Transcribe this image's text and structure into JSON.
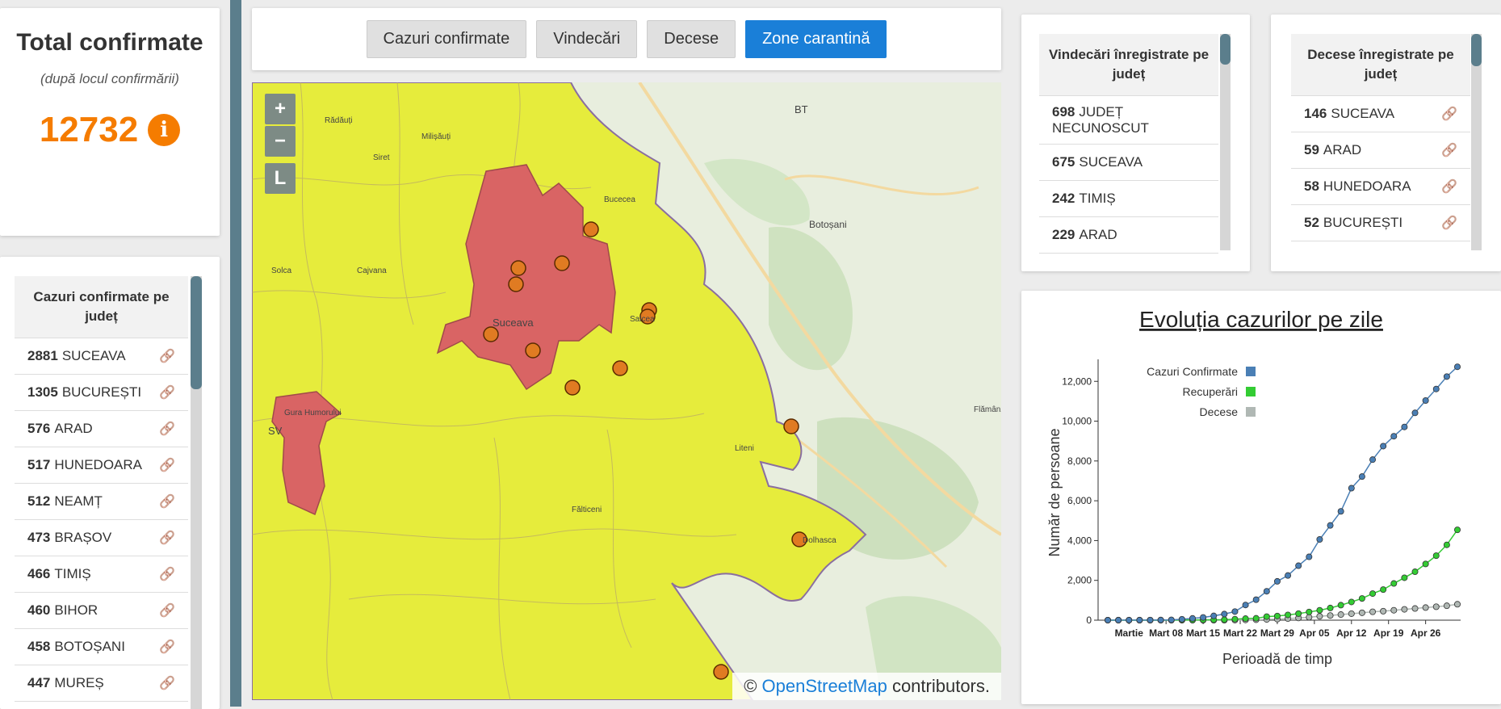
{
  "total": {
    "title": "Total confirmate",
    "subtitle": "(după locul confirmării)",
    "value": "12732",
    "info_icon": "i"
  },
  "tabs": [
    {
      "label": "Cazuri confirmate",
      "active": false
    },
    {
      "label": "Vindecări",
      "active": false
    },
    {
      "label": "Decese",
      "active": false
    },
    {
      "label": "Zone carantină",
      "active": true
    }
  ],
  "county_list": {
    "title": "Cazuri confirmate pe județ",
    "rows": [
      {
        "count": "2881",
        "name": "SUCEAVA"
      },
      {
        "count": "1305",
        "name": "BUCUREȘTI"
      },
      {
        "count": "576",
        "name": "ARAD"
      },
      {
        "count": "517",
        "name": "HUNEDOARA"
      },
      {
        "count": "512",
        "name": "NEAMȚ"
      },
      {
        "count": "473",
        "name": "BRAȘOV"
      },
      {
        "count": "466",
        "name": "TIMIȘ"
      },
      {
        "count": "460",
        "name": "BIHOR"
      },
      {
        "count": "458",
        "name": "BOTOȘANI"
      },
      {
        "count": "447",
        "name": "MUREȘ"
      }
    ]
  },
  "recoveries_list": {
    "title": "Vindecări înregistrate pe județ",
    "rows": [
      {
        "count": "698",
        "name": "JUDEȚ NECUNOSCUT"
      },
      {
        "count": "675",
        "name": "SUCEAVA"
      },
      {
        "count": "242",
        "name": "TIMIȘ"
      },
      {
        "count": "229",
        "name": "ARAD"
      }
    ]
  },
  "deaths_list": {
    "title": "Decese înregistrate pe județ",
    "rows": [
      {
        "count": "146",
        "name": "SUCEAVA"
      },
      {
        "count": "59",
        "name": "ARAD"
      },
      {
        "count": "58",
        "name": "HUNEDOARA"
      },
      {
        "count": "52",
        "name": "BUCUREȘTI"
      }
    ]
  },
  "map": {
    "zoom_in": "+",
    "zoom_out": "−",
    "layers": "L",
    "labels": {
      "suceava": "Suceava",
      "botosani": "Botoșani",
      "bt": "BT",
      "sv": "SV",
      "bucecea": "Bucecea",
      "gura_humorului": "Gura Humorului",
      "falticeni": "Fălticeni",
      "liteni": "Liteni",
      "flamanzi": "Flămânzi",
      "radauti": "Rădăuți",
      "siret": "Siret",
      "salcea": "Salcea",
      "dolhasca": "Dolhasca",
      "solca": "Solca",
      "milisauti": "Milișăuți",
      "cajvana": "Cajvana"
    },
    "attribution_prefix": "© ",
    "attribution_link": "OpenStreetMap",
    "attribution_suffix": " contributors.",
    "colors": {
      "zone_yellow": "#e6ec3c",
      "zone_red": "#d96464",
      "marker": "#e07b22"
    }
  },
  "chart_data": {
    "type": "line",
    "title": "Evoluția cazurilor pe zile",
    "xlabel": "Perioadă de timp",
    "ylabel": "Număr de persoane",
    "ylim": [
      0,
      12700
    ],
    "yticks": [
      "0",
      "2,000",
      "4,000",
      "6,000",
      "8,000",
      "10,000",
      "12,000"
    ],
    "xticks": [
      "Martie",
      "Mart 08",
      "Mart 15",
      "Mart 22",
      "Mart 29",
      "Apr 05",
      "Apr 12",
      "Apr 19",
      "Apr 26"
    ],
    "x": [
      "Feb 26",
      "Feb 28",
      "Mar 01",
      "Mar 03",
      "Mar 05",
      "Mar 07",
      "Mar 09",
      "Mar 11",
      "Mar 13",
      "Mar 15",
      "Mar 17",
      "Mar 19",
      "Mar 21",
      "Mar 23",
      "Mar 25",
      "Mar 27",
      "Mar 29",
      "Mar 31",
      "Apr 02",
      "Apr 04",
      "Apr 06",
      "Apr 08",
      "Apr 10",
      "Apr 12",
      "Apr 14",
      "Apr 16",
      "Apr 18",
      "Apr 20",
      "Apr 22",
      "Apr 24",
      "Apr 26",
      "Apr 28",
      "Apr 30",
      "May 02"
    ],
    "legend_position": "top-left",
    "series": [
      {
        "name": "Cazuri Confirmate",
        "color": "#4a7fb5",
        "values": [
          1,
          3,
          3,
          4,
          6,
          9,
          15,
          47,
          89,
          139,
          217,
          308,
          433,
          762,
          1029,
          1452,
          1952,
          2245,
          2738,
          3183,
          4057,
          4761,
          5467,
          6633,
          7216,
          8067,
          8746,
          9242,
          9710,
          10417,
          11036,
          11616,
          12240,
          12732
        ]
      },
      {
        "name": "Recuperări",
        "color": "#33cc33",
        "values": [
          0,
          0,
          0,
          0,
          0,
          2,
          3,
          6,
          9,
          16,
          19,
          25,
          52,
          79,
          94,
          180,
          209,
          266,
          330,
          413,
          499,
          612,
          755,
          915,
          1091,
          1335,
          1537,
          1845,
          2132,
          2433,
          2825,
          3241,
          3786,
          4539
        ]
      },
      {
        "name": "Decese",
        "color": "#b0b8b4",
        "values": [
          0,
          0,
          0,
          0,
          0,
          0,
          0,
          0,
          0,
          0,
          0,
          0,
          3,
          11,
          22,
          37,
          52,
          79,
          110,
          146,
          197,
          235,
          282,
          326,
          372,
          421,
          451,
          498,
          544,
          587,
          632,
          675,
          724,
          800
        ]
      }
    ]
  }
}
